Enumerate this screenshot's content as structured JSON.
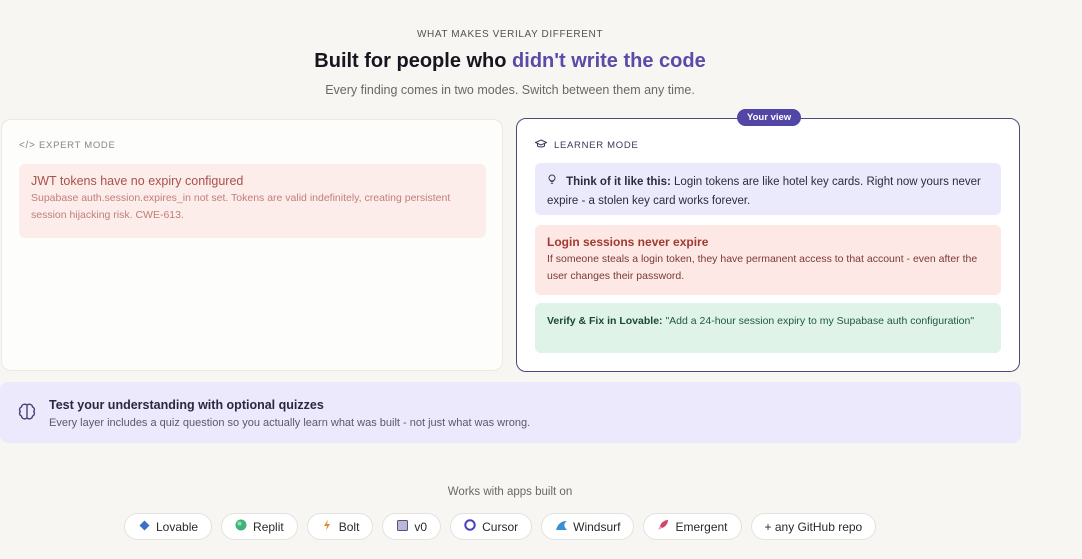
{
  "header": {
    "eyebrow": "WHAT MAKES VERILAY DIFFERENT",
    "headline_prefix": "Built for people who ",
    "headline_accent": "didn't write the code",
    "subhead": "Every finding comes in two modes. Switch between them any time."
  },
  "expert": {
    "mode_icon": "code-icon",
    "mode_label": "EXPERT MODE",
    "issue_title": "JWT tokens have no expiry configured",
    "issue_body": "Supabase auth.session.expires_in not set. Tokens are valid indefinitely, creating persistent session hijacking risk. CWE-613."
  },
  "learner": {
    "badge": "Your view",
    "mode_icon": "graduation-cap-icon",
    "mode_label": "LEARNER MODE",
    "analogy_icon": "lightbulb-icon",
    "analogy_lead": "Think of it like this:",
    "analogy_text": " Login tokens are like hotel key cards. Right now yours never expire - a stolen key card works forever.",
    "issue_title": "Login sessions never expire",
    "issue_body": "If someone steals a login token, they have permanent access to that account - even after the user changes their password.",
    "fix_lead": "Verify & Fix in Lovable:",
    "fix_text": " \"Add a 24-hour session expiry to my Supabase auth configuration\""
  },
  "quiz": {
    "icon": "brain-icon",
    "title": "Test your understanding with optional quizzes",
    "body": "Every layer includes a quiz question so you actually learn what was built - not just what was wrong."
  },
  "works_with": {
    "label": "Works with apps built on",
    "chips": [
      {
        "label": "Lovable",
        "icon": "diamond-icon",
        "color": "#3d6fc4"
      },
      {
        "label": "Replit",
        "icon": "circle-icon",
        "color": "#3fb37a"
      },
      {
        "label": "Bolt",
        "icon": "bolt-icon",
        "color": "#e08a3c"
      },
      {
        "label": "v0",
        "icon": "square-icon",
        "color": "#7a7aa8"
      },
      {
        "label": "Cursor",
        "icon": "ring-icon",
        "color": "#4a3fbf"
      },
      {
        "label": "Windsurf",
        "icon": "wave-icon",
        "color": "#3a8fd0"
      },
      {
        "label": "Emergent",
        "icon": "rocket-icon",
        "color": "#d0466a"
      },
      {
        "label": "+ any GitHub repo",
        "icon": "",
        "color": ""
      }
    ]
  }
}
